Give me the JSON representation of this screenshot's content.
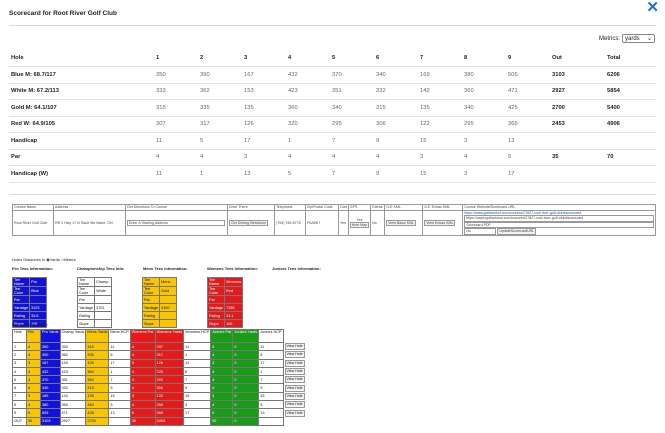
{
  "title": "Scorecard for Root River Golf Club",
  "metrics": {
    "label": "Metrics:",
    "value": "yards"
  },
  "scorecard": {
    "headers": [
      "Hole",
      "1",
      "2",
      "3",
      "4",
      "5",
      "6",
      "7",
      "8",
      "9",
      "Out",
      "Total"
    ],
    "rows": [
      [
        "Blue M: 68.7/117",
        "350",
        "390",
        "167",
        "432",
        "370",
        "340",
        "169",
        "380",
        "505",
        "3103",
        "6206"
      ],
      [
        "White M: 67.2/113",
        "333",
        "362",
        "153",
        "423",
        "351",
        "332",
        "142",
        "360",
        "471",
        "2927",
        "5854"
      ],
      [
        "Gold M: 64.1/107",
        "315",
        "335",
        "135",
        "360",
        "340",
        "315",
        "135",
        "340",
        "425",
        "2700",
        "5400"
      ],
      [
        "Red W: 64.9/105",
        "307",
        "317",
        "126",
        "320",
        "295",
        "306",
        "122",
        "295",
        "365",
        "2453",
        "4906"
      ],
      [
        "Handicap",
        "11",
        "5",
        "17",
        "1",
        "7",
        "9",
        "15",
        "3",
        "13",
        "",
        ""
      ],
      [
        "Par",
        "4",
        "4",
        "3",
        "4",
        "4",
        "4",
        "3",
        "4",
        "5",
        "35",
        "70"
      ],
      [
        "Handicap (W)",
        "11",
        "1",
        "13",
        "5",
        "7",
        "9",
        "15",
        "3",
        "17",
        "",
        ""
      ]
    ]
  },
  "info": {
    "headers": [
      "Course Name",
      "Address",
      "Get Directions To Course",
      "Drive There",
      "Telephone",
      "Zip/Postal Code",
      "Cart",
      "GPS",
      "Extras",
      "G-E KML",
      "G-E Extras KML",
      "Course Website/Scorecard URL"
    ],
    "course_name": "Root River Golf Club",
    "address": "RR 2 Hwy 17 N Sault Ste Marie, ON",
    "address_placeholder": "Enter A Starting Address",
    "driving_btn": "Get Driving Directions",
    "telephone": "(705) 759-8775",
    "zip": "P6A5K7",
    "cart": "Yes",
    "gps_yes": "Yes",
    "gps_btn": "Hole Map",
    "extras": "No",
    "kml_btn": "View Basic KML",
    "extras_kml_btn": "View Extras KML",
    "url_link": "https://www.golfadvisor.com/courses/27827-root-river-golf-club#scorecard",
    "url_input": "https://www.golfadvisor.com/courses/27827-root-river-golf-club#scorecard",
    "pdf_input": "Scorecard PDF",
    "no_value": "No",
    "update_btn": "UpdateScorecardURL"
  },
  "legend": {
    "text": "Holes Distances in",
    "yards": "Yards",
    "meters": "Meters"
  },
  "tee_sections": [
    "Pro Tees Information:",
    "Championship Tees Info:",
    "Mens Tees Information:",
    "Womens Tees Information:",
    "Juniors Tees Information:"
  ],
  "tee_labels": [
    "Tee Name",
    "Tee Color",
    "Par",
    "Yardage",
    "Rating",
    "Slope"
  ],
  "pro_tee": [
    "Pro",
    "Blue",
    "",
    "3103",
    "33.6",
    "106"
  ],
  "champ_tee": [
    "Champ",
    "White",
    "",
    "3701",
    "",
    ""
  ],
  "mens_tee": [
    "Mens",
    "Gold",
    "",
    "3100",
    "",
    ""
  ],
  "womens_tee": [
    "Womens",
    "Red",
    "",
    "7335",
    "34.1",
    "106"
  ],
  "course_scorecard_label": "Course Scorecard:",
  "grid": {
    "headers": [
      "Hole",
      "Par",
      "Pro Yards",
      "Champ Yards",
      "Mens Yards",
      "Mens HCP",
      "Womens Par",
      "Womens Yards",
      "Womens HCP",
      "Juniors Par",
      "Juniors Yards",
      "Juniors HCP"
    ],
    "view_hole": "View Hole",
    "rows": [
      [
        "1",
        "4",
        "350",
        "333",
        "315",
        "11",
        "4",
        "307",
        "11",
        "4",
        "0",
        "11"
      ],
      [
        "2",
        "4",
        "390",
        "362",
        "335",
        "5",
        "4",
        "317",
        "1",
        "4",
        "0",
        "5"
      ],
      [
        "3",
        "3",
        "167",
        "153",
        "135",
        "17",
        "3",
        "126",
        "13",
        "3",
        "0",
        "17"
      ],
      [
        "4",
        "4",
        "432",
        "423",
        "360",
        "1",
        "4",
        "320",
        "5",
        "4",
        "0",
        "1"
      ],
      [
        "5",
        "4",
        "370",
        "351",
        "340",
        "7",
        "4",
        "295",
        "7",
        "4",
        "0",
        "7"
      ],
      [
        "6",
        "4",
        "340",
        "332",
        "315",
        "9",
        "4",
        "306",
        "9",
        "4",
        "0",
        "9"
      ],
      [
        "7",
        "3",
        "169",
        "142",
        "135",
        "15",
        "3",
        "122",
        "15",
        "3",
        "0",
        "15"
      ],
      [
        "8",
        "4",
        "380",
        "360",
        "340",
        "3",
        "4",
        "295",
        "3",
        "4",
        "0",
        "3"
      ],
      [
        "9",
        "5",
        "505",
        "471",
        "425",
        "13",
        "5",
        "365",
        "17",
        "5",
        "0",
        "13"
      ],
      [
        "OUT",
        "35",
        "3103",
        "2927",
        "2700",
        "",
        "35",
        "2453",
        "",
        "35",
        "0",
        ""
      ]
    ]
  }
}
